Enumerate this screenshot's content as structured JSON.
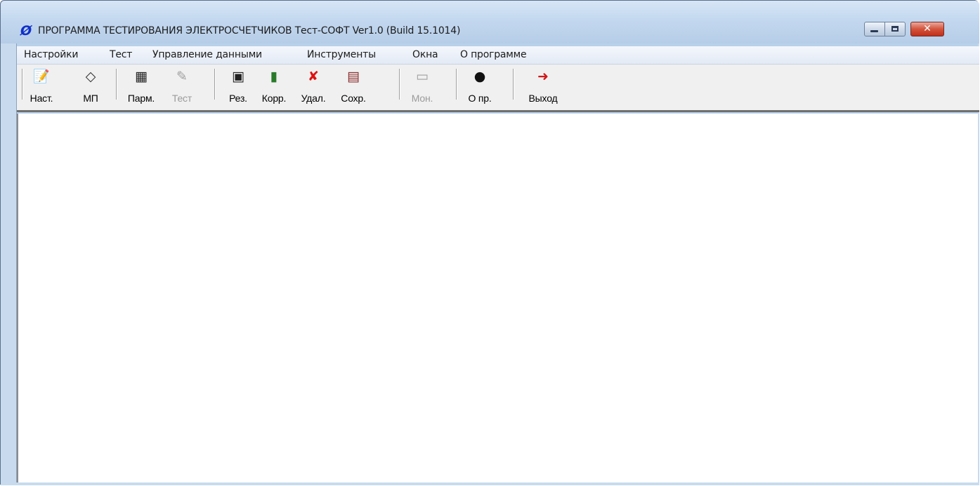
{
  "window": {
    "title": "ПРОГРАММА ТЕСТИРОВАНИЯ ЭЛЕКТРОСЧЕТЧИКОВ Тест-СОФТ   Ver1.0 (Build 15.1014)",
    "icon": "app-logo-icon",
    "controls": {
      "minimize_icon": "minimize-icon",
      "maximize_icon": "maximize-icon",
      "close_icon": "close-icon",
      "close_glyph": "✕"
    }
  },
  "menubar": {
    "items": [
      {
        "label": "Настройки"
      },
      {
        "label": "Тест"
      },
      {
        "label": "Управление данными"
      },
      {
        "label": "Инструменты"
      },
      {
        "label": "Окна"
      },
      {
        "label": "О программе"
      }
    ]
  },
  "toolbar": {
    "buttons": [
      {
        "label": "Наст.",
        "icon": "settings-icon",
        "glyph": "📝",
        "enabled": true
      },
      {
        "label": "МП",
        "icon": "eraser-icon",
        "glyph": "◇",
        "enabled": true
      },
      {
        "label": "Парм.",
        "icon": "keyboard-icon",
        "glyph": "▦",
        "enabled": true
      },
      {
        "label": "Тест",
        "icon": "tools-icon",
        "glyph": "✎",
        "enabled": false
      },
      {
        "label": "Рез.",
        "icon": "results-icon",
        "glyph": "▣",
        "enabled": true
      },
      {
        "label": "Корр.",
        "icon": "books-icon",
        "glyph": "▮",
        "enabled": true
      },
      {
        "label": "Удал.",
        "icon": "delete-icon",
        "glyph": "✘",
        "enabled": true
      },
      {
        "label": "Сохр.",
        "icon": "save-copy-icon",
        "glyph": "▤",
        "enabled": true
      },
      {
        "label": "Мон.",
        "icon": "monitor-icon",
        "glyph": "▭",
        "enabled": false
      },
      {
        "label": "О пр.",
        "icon": "info-icon",
        "glyph": "●",
        "enabled": true
      },
      {
        "label": "Выход",
        "icon": "exit-icon",
        "glyph": "➜",
        "enabled": true
      }
    ]
  },
  "colors": {
    "titlebar_bg": "#c3d8ef",
    "toolbar_bg": "#f0f0f0",
    "client_bg": "#ffffff",
    "close_button": "#c0301a",
    "disabled_text": "#9a9a9a",
    "app_icon": "#1030c8"
  }
}
